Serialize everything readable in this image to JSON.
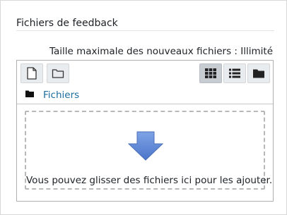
{
  "section": {
    "title": "Fichiers de feedback"
  },
  "filemanager": {
    "max_size_text": "Taille maximale des nouveaux fichiers : Illimité",
    "toolbar": {
      "add_file_icon": "file-icon",
      "create_folder_icon": "folder-icon",
      "view_icons_icon": "grid-icon",
      "view_list_icon": "list-icon",
      "view_tree_icon": "folder-solid-icon",
      "active_view": "icons"
    },
    "path": {
      "label": "Fichiers"
    },
    "dropzone": {
      "message": "Vous pouvez glisser des fichiers ici pour les ajouter.",
      "arrow_color": "#5b86d6"
    }
  }
}
